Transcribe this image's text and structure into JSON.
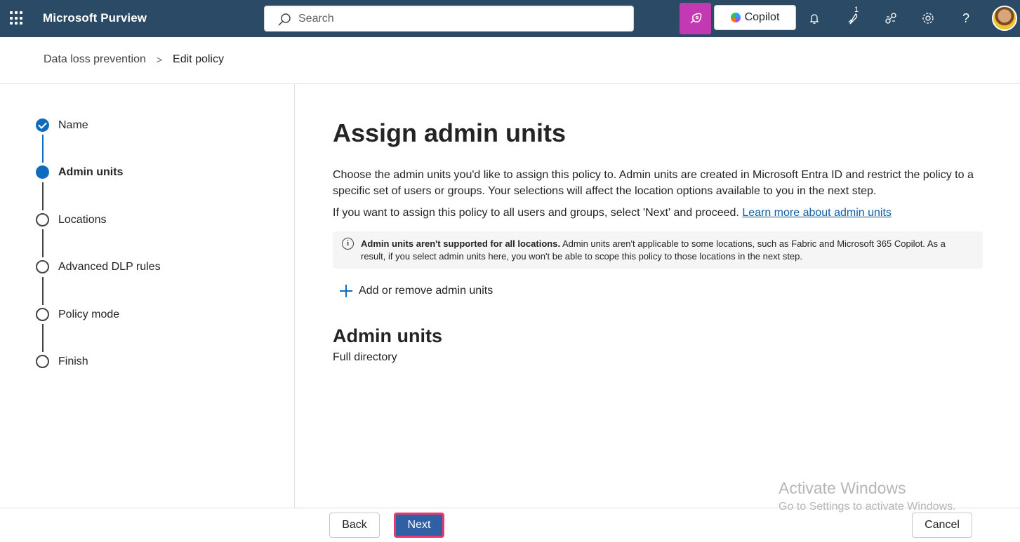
{
  "topbar": {
    "app_title": "Microsoft Purview",
    "search_placeholder": "Search",
    "copilot_label": "Copilot",
    "notification_count": "1",
    "colors": {
      "bar": "#2b4a66",
      "agent_button": "#c239b3"
    },
    "icons": [
      "app-launcher-icon",
      "search-icon",
      "agent-icon",
      "copilot-icon",
      "bell-icon",
      "badge-icon",
      "connections-icon",
      "gear-icon",
      "help-icon",
      "avatar"
    ]
  },
  "breadcrumb": {
    "parent": "Data loss prevention",
    "separator": ">",
    "current": "Edit policy"
  },
  "stepper": {
    "steps": [
      {
        "label": "Name",
        "state": "done"
      },
      {
        "label": "Admin units",
        "state": "current"
      },
      {
        "label": "Locations",
        "state": "todo"
      },
      {
        "label": "Advanced DLP rules",
        "state": "todo"
      },
      {
        "label": "Policy mode",
        "state": "todo"
      },
      {
        "label": "Finish",
        "state": "todo"
      }
    ],
    "accent": "#0f6cbd"
  },
  "main": {
    "title": "Assign admin units",
    "description": "Choose the admin units you'd like to assign this policy to. Admin units are created in Microsoft Entra ID and restrict the policy to a specific set of users or groups. Your selections will affect the location options available to you in the next step.",
    "description2": "If you want to assign this policy to all users and groups, select 'Next' and proceed. ",
    "learn_more_link": "Learn more about admin units",
    "info": {
      "bold": "Admin units aren't supported for all locations.",
      "text": " Admin units aren't applicable to some locations, such as Fabric and Microsoft 365 Copilot. As a result, if you select admin units here, you won't be able to scope this policy to those locations in the next step."
    },
    "add_button": "Add or remove admin units",
    "section_title": "Admin units",
    "section_value": "Full directory"
  },
  "footer": {
    "back": "Back",
    "next": "Next",
    "cancel": "Cancel",
    "next_highlight_color": "#e33b6b"
  },
  "watermark": {
    "line1": "Activate Windows",
    "line2": "Go to Settings to activate Windows."
  }
}
